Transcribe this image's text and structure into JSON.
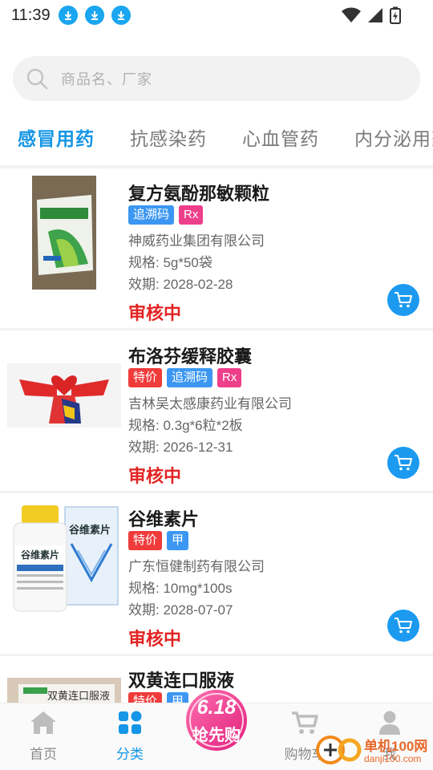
{
  "status_bar": {
    "time": "11:39"
  },
  "search": {
    "placeholder": "商品名、厂家"
  },
  "tabs": [
    "感冒用药",
    "抗感染药",
    "心血管药",
    "内分泌用药"
  ],
  "products": [
    {
      "name": "复方氨酚那敏颗粒",
      "tags": [
        "追溯码",
        "Rx"
      ],
      "manufacturer": "神威药业集团有限公司",
      "spec": "规格: 5g*50袋",
      "expiry": "效期: 2028-02-28",
      "status": "审核中"
    },
    {
      "name": "布洛芬缓释胶囊",
      "tags": [
        "特价",
        "追溯码",
        "Rx"
      ],
      "manufacturer": "吉林吴太感康药业有限公司",
      "spec": "规格: 0.3g*6粒*2板",
      "expiry": "效期: 2026-12-31",
      "status": "审核中"
    },
    {
      "name": "谷维素片",
      "tags": [
        "特价",
        "甲"
      ],
      "manufacturer": "广东恒健制药有限公司",
      "spec": "规格: 10mg*100s",
      "expiry": "效期: 2028-07-07",
      "status": "审核中"
    },
    {
      "name": "双黄连口服液",
      "tags": [
        "特价",
        "甲"
      ]
    }
  ],
  "box_labels": {
    "gu_wei_su": "谷维素片",
    "shuang_huang": "双黄连口服液"
  },
  "bottom_nav": {
    "home": "首页",
    "category": "分类",
    "cart": "购物车",
    "me": "我",
    "promo_top": "6.18",
    "promo_bottom": "抢先购"
  },
  "watermark": {
    "title": "单机100网",
    "url": "danji100.com"
  },
  "colors": {
    "accent": "#1596e6",
    "status_red": "#e22323",
    "tag_blue": "#3c97f2",
    "tag_pink": "#ee3f8b",
    "tag_red": "#f03b3b"
  }
}
